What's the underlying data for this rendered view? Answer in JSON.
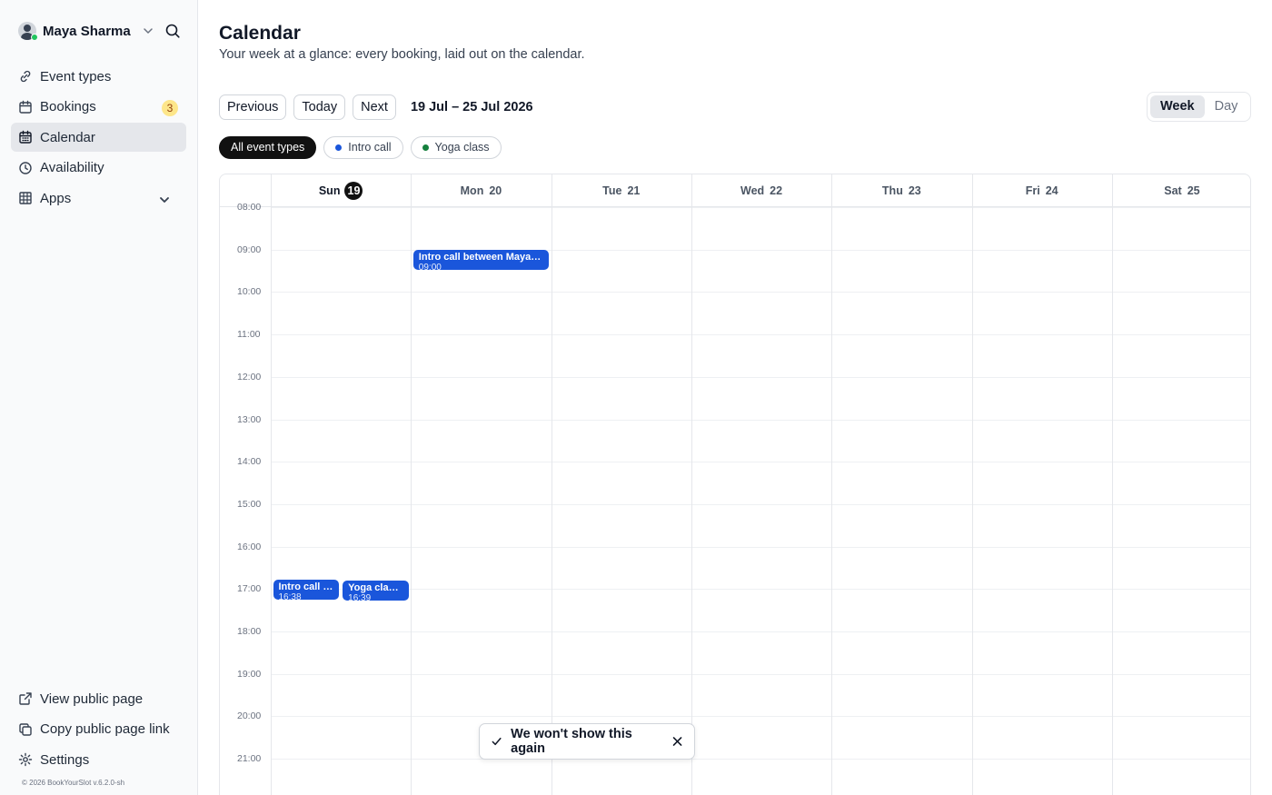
{
  "user": {
    "name": "Maya Sharma"
  },
  "sidebar": {
    "items": [
      {
        "label": "Event types",
        "icon": "link-icon"
      },
      {
        "label": "Bookings",
        "icon": "calendar-icon",
        "badge": "3"
      },
      {
        "label": "Calendar",
        "icon": "calendar-grid-icon",
        "active": true
      },
      {
        "label": "Availability",
        "icon": "clock-icon"
      },
      {
        "label": "Apps",
        "icon": "grid-icon"
      }
    ],
    "bottom_items": [
      {
        "label": "View public page",
        "icon": "external-link-icon"
      },
      {
        "label": "Copy public page link",
        "icon": "copy-icon"
      },
      {
        "label": "Settings",
        "icon": "gear-icon"
      }
    ],
    "footer": "© 2026 BookYourSlot v.6.2.0-sh"
  },
  "page": {
    "title": "Calendar",
    "subtitle": "Your week at a glance: every booking, laid out on the calendar."
  },
  "toolbar": {
    "previous": "Previous",
    "today": "Today",
    "next": "Next",
    "range": "19 Jul – 25 Jul 2026"
  },
  "view_toggle": {
    "week": "Week",
    "day": "Day",
    "selected": "Week"
  },
  "filters": [
    {
      "label": "All event types",
      "active": true
    },
    {
      "label": "Intro call",
      "color": "#1a56db"
    },
    {
      "label": "Yoga class",
      "color": "#15803d"
    }
  ],
  "calendar": {
    "days": [
      {
        "name": "Sun",
        "num": "19",
        "today": true
      },
      {
        "name": "Mon",
        "num": "20"
      },
      {
        "name": "Tue",
        "num": "21"
      },
      {
        "name": "Wed",
        "num": "22"
      },
      {
        "name": "Thu",
        "num": "23"
      },
      {
        "name": "Fri",
        "num": "24"
      },
      {
        "name": "Sat",
        "num": "25"
      }
    ],
    "hours": [
      "08:00",
      "09:00",
      "10:00",
      "11:00",
      "12:00",
      "13:00",
      "14:00",
      "15:00",
      "16:00",
      "17:00",
      "18:00",
      "19:00",
      "20:00",
      "21:00"
    ],
    "events": [
      {
        "title": "Intro call between Maya Sharma",
        "time": "09:00",
        "day": 1,
        "start_hour": 9.0
      },
      {
        "title": "Intro call between Maya Sharma",
        "time": "16:38",
        "day": 0,
        "start_hour": 16.78
      },
      {
        "title": "Yoga class between Maya Sharma",
        "time": "16:39",
        "day": 0,
        "start_hour": 16.8
      }
    ],
    "event_color": "#1a56db"
  },
  "toast": {
    "text": "We won't show this again"
  }
}
